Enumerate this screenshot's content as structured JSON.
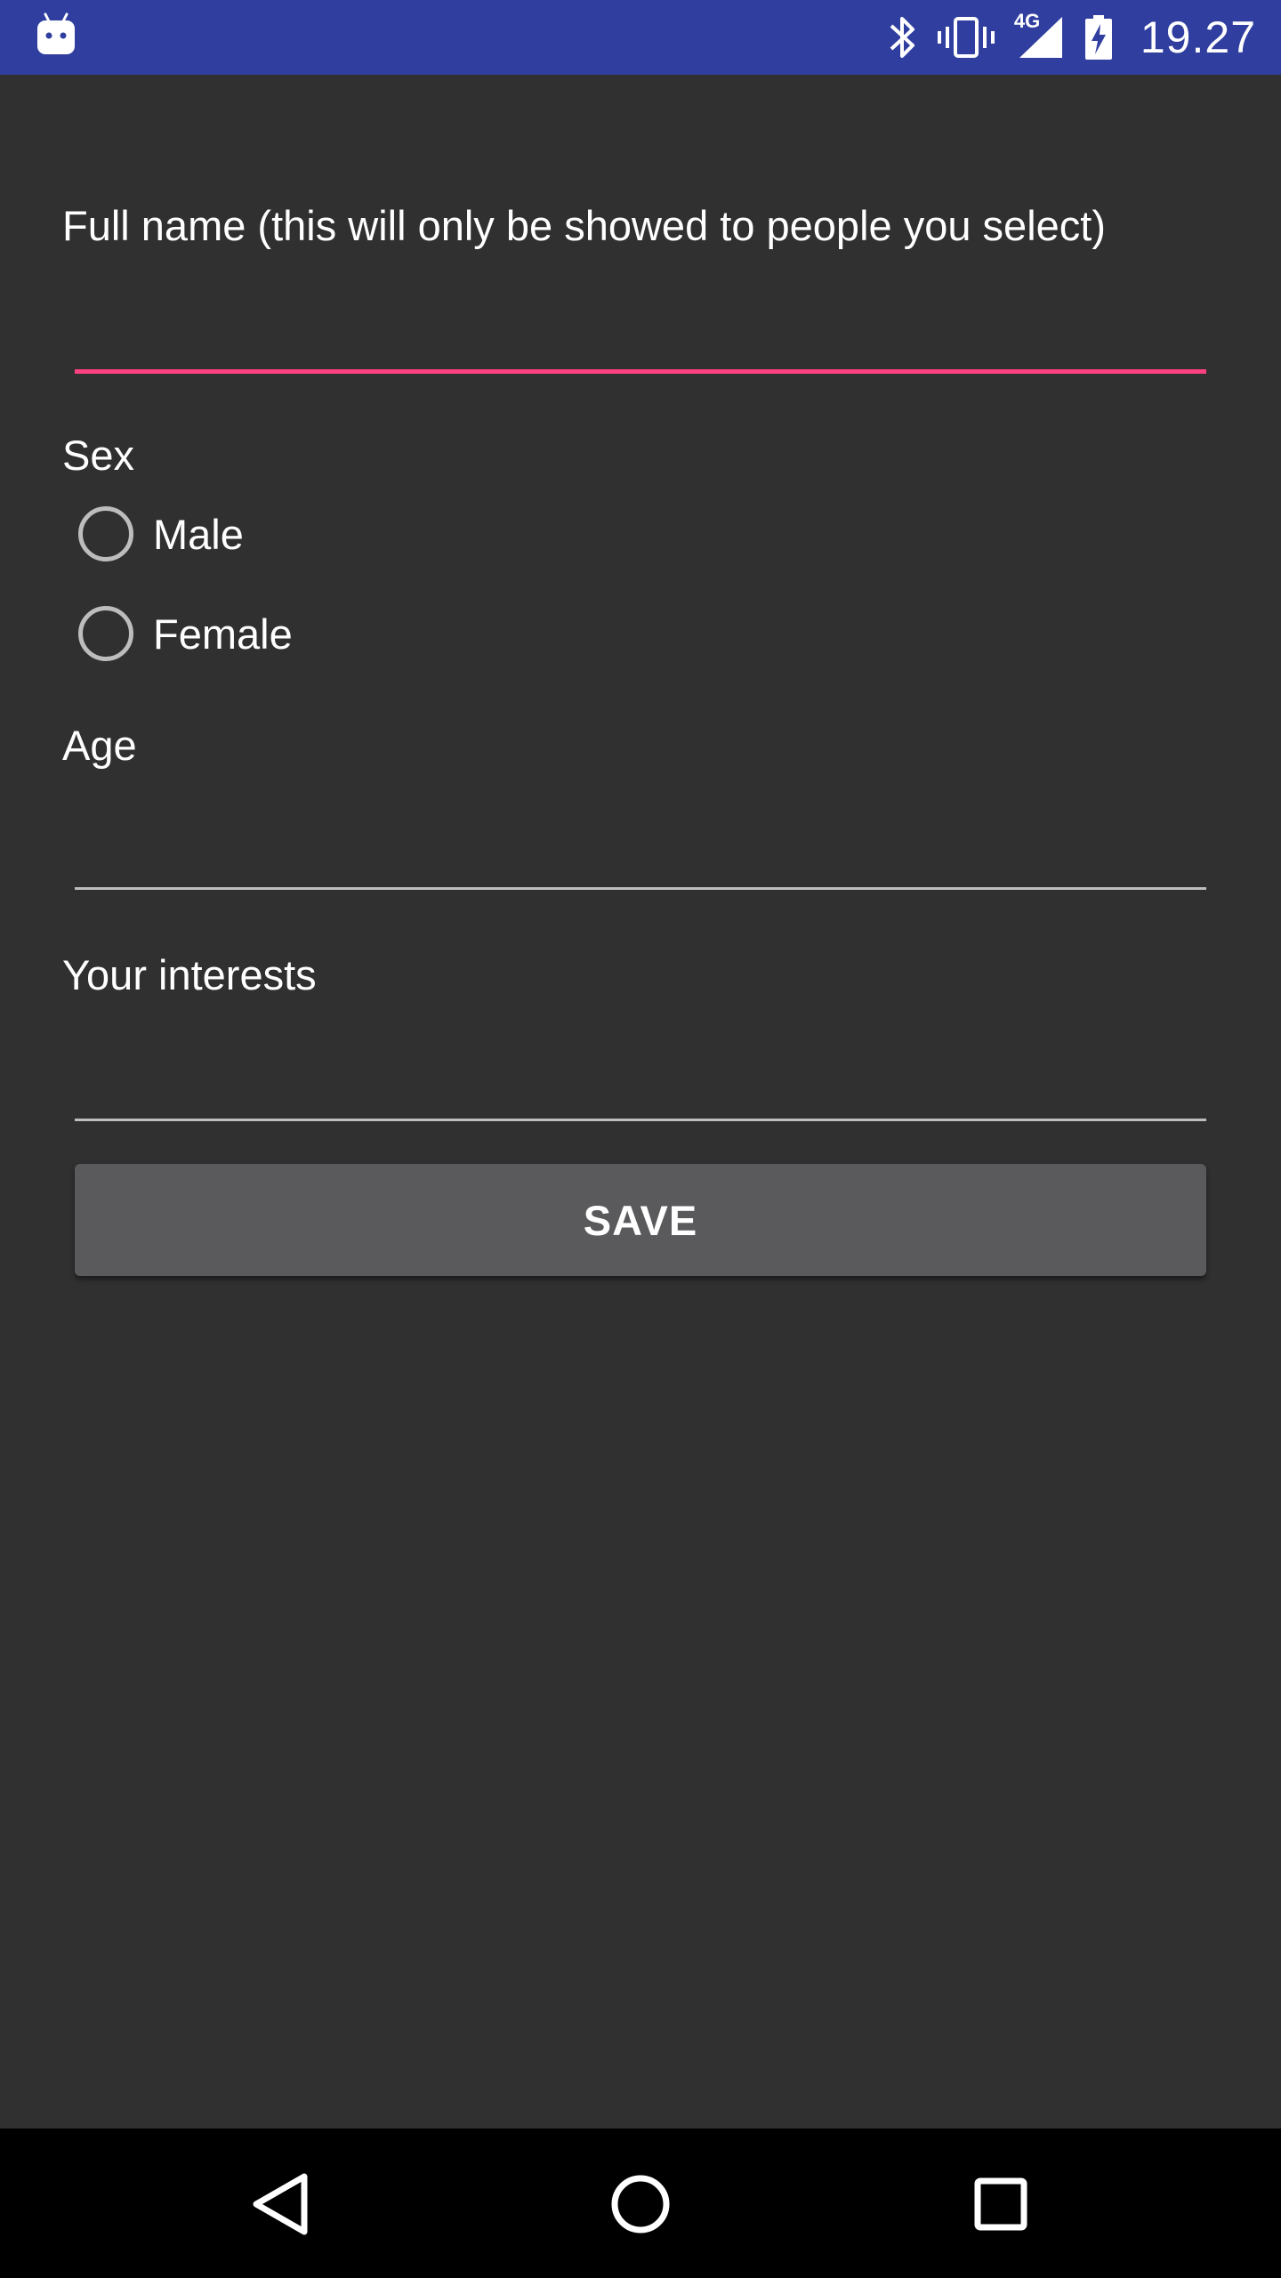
{
  "status_bar": {
    "time": "19.27",
    "network_type": "4G",
    "background_color": "#303F9F",
    "icons": [
      "android-icon",
      "bluetooth-icon",
      "vibrate-icon",
      "signal-icon",
      "battery-charging-icon"
    ]
  },
  "form": {
    "full_name": {
      "label": "Full name (this will only be showed to people you select)",
      "value": "",
      "underline_color": "#FF4081"
    },
    "sex": {
      "label": "Sex",
      "options": [
        {
          "label": "Male",
          "selected": false
        },
        {
          "label": "Female",
          "selected": false
        }
      ]
    },
    "age": {
      "label": "Age",
      "value": ""
    },
    "interests": {
      "label": "Your interests",
      "value": ""
    },
    "save_label": "SAVE"
  },
  "nav_bar": {
    "buttons": [
      "back-icon",
      "home-icon",
      "recents-icon"
    ]
  }
}
